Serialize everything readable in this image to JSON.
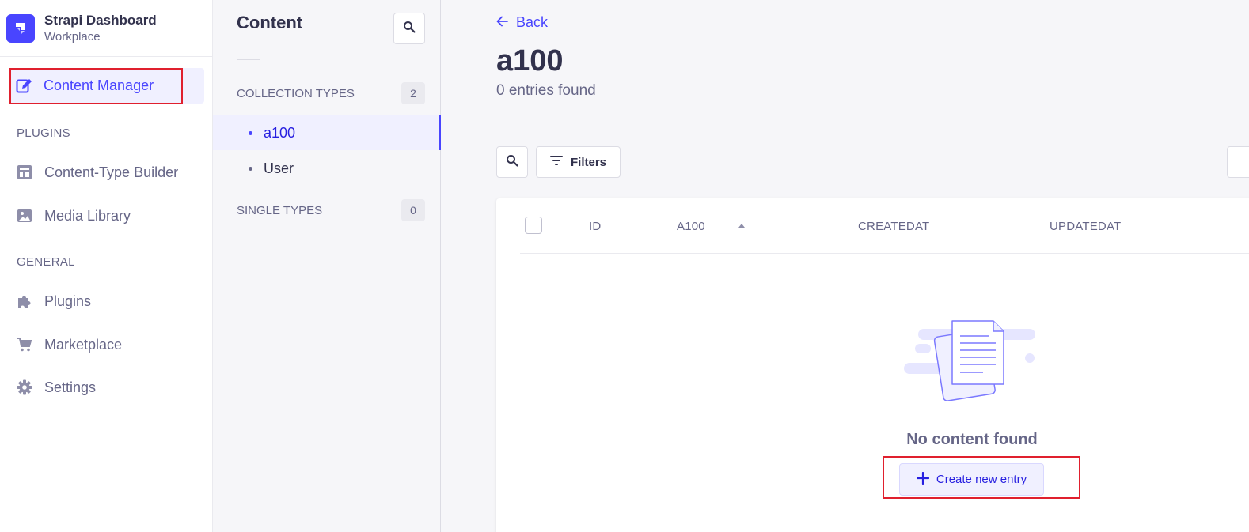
{
  "brand": {
    "title": "Strapi Dashboard",
    "subtitle": "Workplace"
  },
  "nav": {
    "active_item": "Content Manager",
    "sections": {
      "plugins": "PLUGINS",
      "general": "GENERAL"
    },
    "items": {
      "content_type_builder": "Content-Type Builder",
      "media_library": "Media Library",
      "plugins": "Plugins",
      "marketplace": "Marketplace",
      "settings": "Settings"
    }
  },
  "subnav": {
    "title": "Content",
    "collection_types": {
      "label": "COLLECTION TYPES",
      "count": "2",
      "items": [
        "a100",
        "User"
      ],
      "active": "a100"
    },
    "single_types": {
      "label": "SINGLE TYPES",
      "count": "0"
    }
  },
  "main": {
    "back_label": "Back",
    "title": "a100",
    "subtitle": "0 entries found",
    "filters_label": "Filters",
    "table": {
      "columns": [
        "ID",
        "A100",
        "CREATEDAT",
        "UPDATEDAT"
      ],
      "sorted_column": "A100",
      "sort_direction": "ascending"
    },
    "empty_text": "No content found",
    "create_label": "Create new entry"
  },
  "colors": {
    "accent": "#4945ff",
    "highlight": "#e0202e",
    "text_primary": "#32324d",
    "text_secondary": "#666687"
  }
}
